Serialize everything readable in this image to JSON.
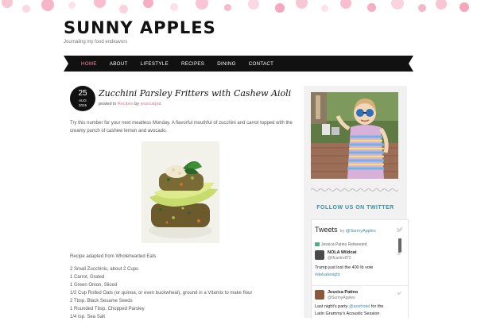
{
  "site": {
    "title": "SUNNY APPLES",
    "tagline": "Journaling my food endeavors"
  },
  "nav": {
    "items": [
      {
        "label": "HOME",
        "active": true
      },
      {
        "label": "ABOUT",
        "active": false
      },
      {
        "label": "LIFESTYLE",
        "active": false
      },
      {
        "label": "RECIPES",
        "active": false
      },
      {
        "label": "DINING",
        "active": false
      },
      {
        "label": "CONTACT",
        "active": false
      }
    ]
  },
  "post": {
    "date": {
      "day": "25",
      "month": "AUG",
      "year": "2015"
    },
    "title": "Zucchini Parsley Fritters with Cashew Aioli",
    "meta": {
      "posted_in": "posted in",
      "category": "Recipes",
      "by": "by",
      "author": "jessicalpat"
    },
    "excerpt": "Try this number for your next meatless Monday. A flavorful mouthful of zucchini and carrot topped with the creamy punch of cashew lemon and avocado.",
    "adapted": "Recipe adapted from Wholehearted Eats",
    "ingredients": [
      "2 Small Zucchinis, about 2 Cups",
      "1 Carrot, Grated",
      "1 Green Onion, Sliced",
      "1/2 Cup Rolled Oats (or quinoa, or even buckwheat), ground in a Vitamix to make flour",
      "2 Tbsp. Black Sesame Seeds",
      "1 Rounded Tbsp. Chopped Parsley",
      "1/4 tsp. Sea Salt"
    ]
  },
  "sidebar": {
    "follow_heading": "FOLLOW US ON TWITTER",
    "twitter": {
      "title": "Tweets",
      "by_label": "by",
      "handle": "@SunnyApples",
      "retweet_note": "Jessica Patino Retweeted",
      "tweets": [
        {
          "name": "NOLA Wildcat",
          "handle": "@tfcantrell72",
          "text": "Trump just lost the 400 lb vote",
          "hashtag": "#debatenight"
        },
        {
          "name": "Jessica Patino",
          "handle": "@SunnyApples",
          "text_pre": "Last night's party",
          "mention": "@acehotel",
          "text_post": "for the",
          "line2": "Latin Grammy's Acoustic Session"
        }
      ]
    }
  },
  "colors": {
    "accent_pink": "#f58a9c",
    "link_pink": "#e07a8a",
    "teal": "#3d8ea3",
    "nav_bg": "#111111"
  }
}
